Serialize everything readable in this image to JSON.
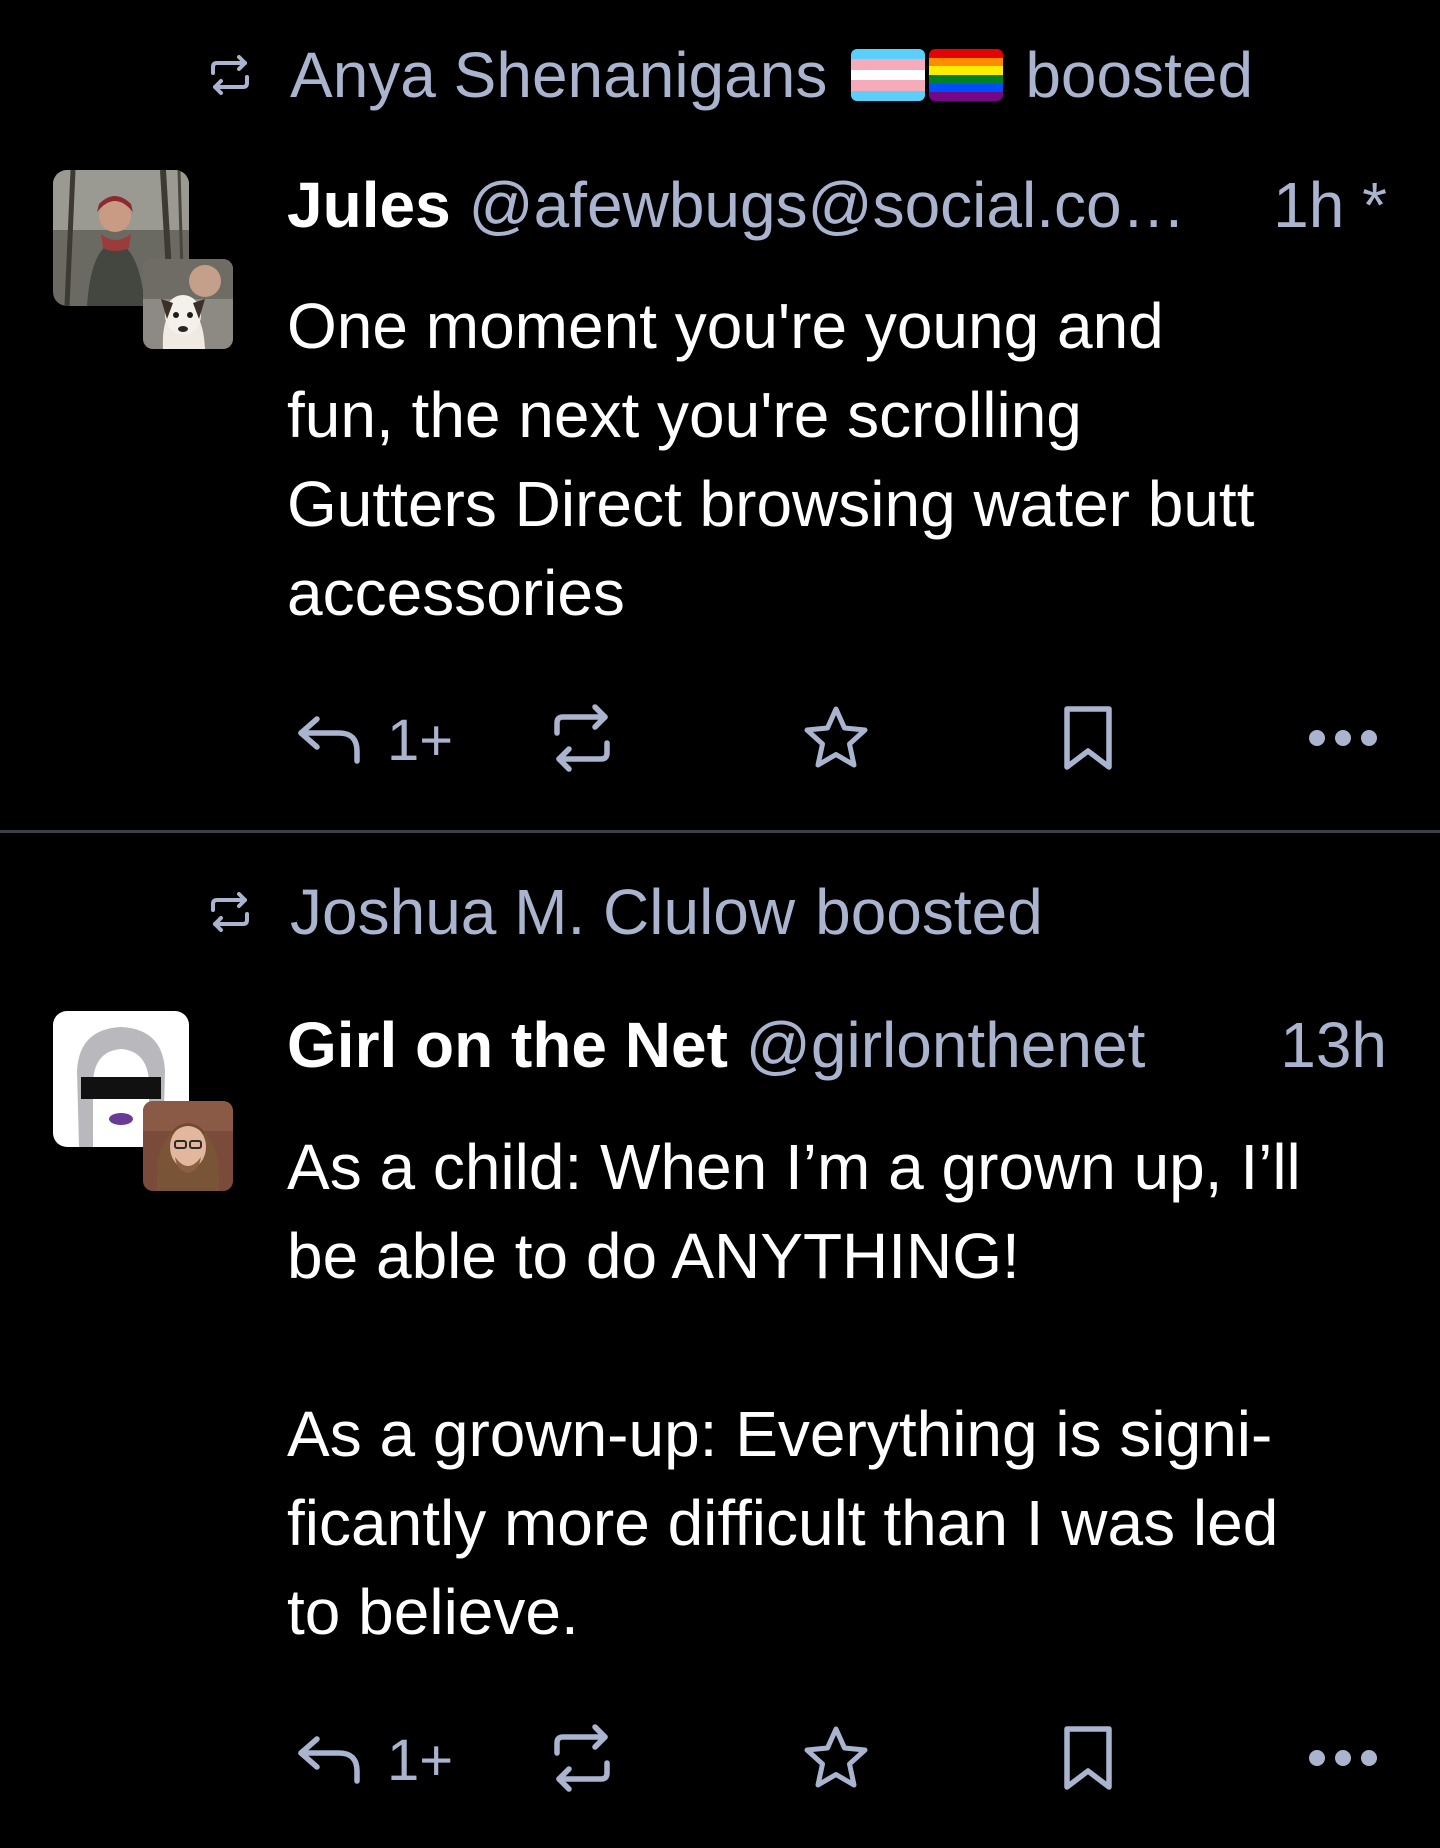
{
  "colors": {
    "background": "#000000",
    "divider": "#3a3e49",
    "muted_text": "#aab4cf",
    "primary_text": "#ffffff"
  },
  "posts": [
    {
      "boosted_by": "Anya Shenanigans",
      "boost_suffix": "boosted",
      "flags": [
        "transgender-flag",
        "rainbow-pride-flag"
      ],
      "author": {
        "display_name": "Jules",
        "handle": "@afewbugs@social.co…",
        "avatar": "avatar-jules",
        "booster_avatar": "avatar-anya"
      },
      "timestamp": "1h *",
      "content": [
        "One moment you're young and",
        "fun, the next you're scrolling",
        "Gutters Direct browsing water butt",
        "accessories"
      ],
      "actions": {
        "reply_icon": "reply-icon",
        "reply_count": "1+",
        "boost_icon": "boost-icon",
        "favourite_icon": "star-icon",
        "bookmark_icon": "bookmark-icon",
        "more_icon": "more-icon"
      }
    },
    {
      "boosted_by": "Joshua M. Clulow",
      "boost_suffix": "boosted",
      "author": {
        "display_name": "Girl on the Net",
        "handle": "@girlonthenet",
        "avatar": "avatar-girl-on-the-net",
        "booster_avatar": "avatar-joshua"
      },
      "timestamp": "13h",
      "content_paragraphs": [
        [
          "As a child: When I’m a grown up, I’ll",
          "be able to do ANYTHING!"
        ],
        [
          "As a grown-up: Everything is signi-",
          "ficantly more difficult than I was led",
          "to believe."
        ]
      ],
      "actions": {
        "reply_icon": "reply-icon",
        "reply_count": "1+",
        "boost_icon": "boost-icon",
        "favourite_icon": "star-icon",
        "bookmark_icon": "bookmark-icon",
        "more_icon": "more-icon"
      }
    }
  ]
}
